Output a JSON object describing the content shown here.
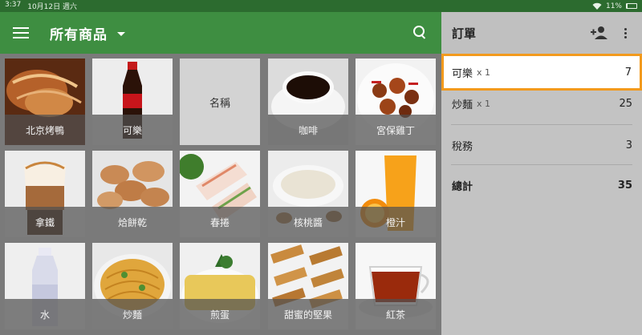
{
  "status": {
    "time": "3:37",
    "date": "10月12日 週六",
    "battery": "11%"
  },
  "appbar": {
    "title": "所有商品",
    "icons": [
      "menu-icon",
      "dropdown-icon",
      "search-icon"
    ]
  },
  "products": [
    {
      "label": "北京烤鴨"
    },
    {
      "label": "可樂"
    },
    {
      "label": "名稱"
    },
    {
      "label": "咖啡"
    },
    {
      "label": "宮保雞丁"
    },
    {
      "label": "拿鐵"
    },
    {
      "label": "烚餅乾"
    },
    {
      "label": "春捲"
    },
    {
      "label": "核桃醬"
    },
    {
      "label": "橙汁"
    },
    {
      "label": "水"
    },
    {
      "label": "炒麵"
    },
    {
      "label": "煎蛋"
    },
    {
      "label": "甜蜜的堅果"
    },
    {
      "label": "紅茶"
    }
  ],
  "order": {
    "title": "訂單",
    "items": [
      {
        "name": "可樂",
        "qty": "x 1",
        "amount": "7"
      },
      {
        "name": "炒麵",
        "qty": "x 1",
        "amount": "25"
      }
    ],
    "tax_label": "稅務",
    "tax_amount": "3",
    "total_label": "總計",
    "total_amount": "35"
  },
  "colors": {
    "appbar": "#3e8e41",
    "statusbar": "#2c6b2f",
    "selection": "#f29a1d"
  }
}
